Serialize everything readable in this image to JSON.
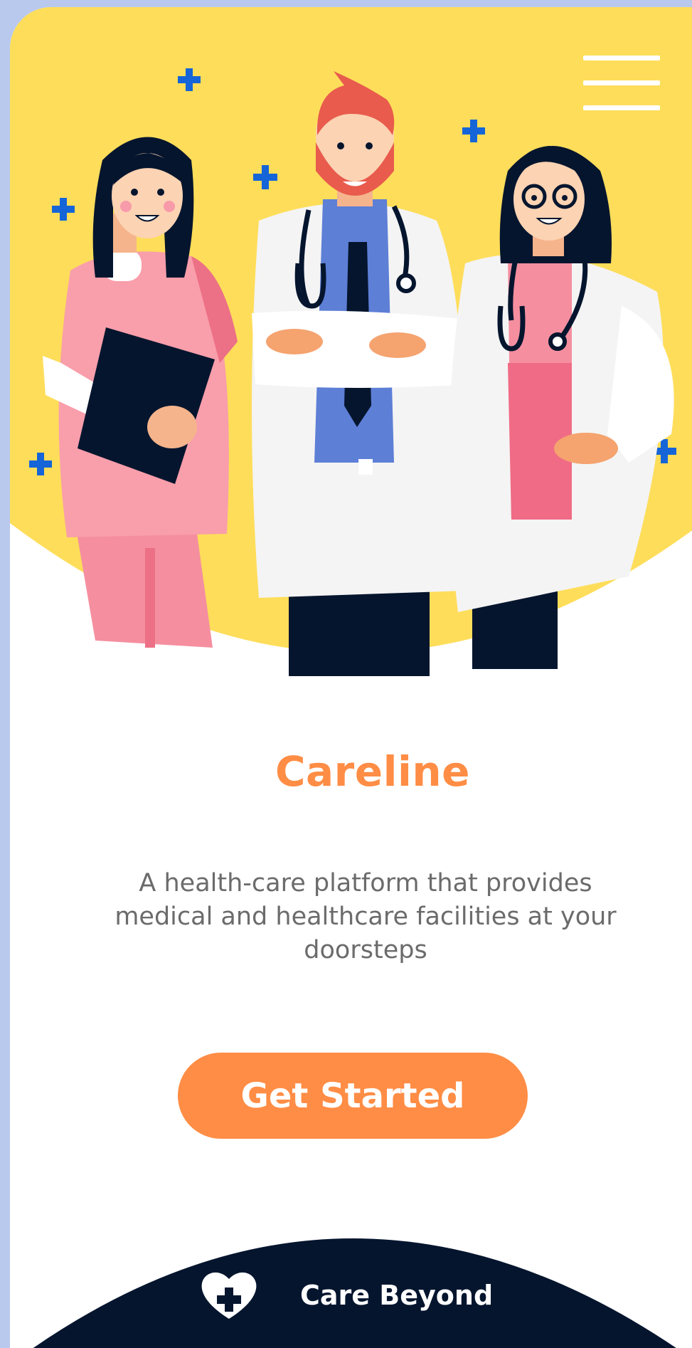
{
  "app": {
    "title": "Careline",
    "tagline": "A health-care platform that provides medical and healthcare facilities at your doorsteps"
  },
  "hero": {
    "illustration": "three-doctors-illustration",
    "background_color": "#fedd5a"
  },
  "menu": {
    "icon": "hamburger-menu-icon"
  },
  "cta": {
    "label": "Get Started",
    "color": "#ff8d45"
  },
  "footer": {
    "brand_label": "Care Beyond",
    "icon": "heart-plus-icon",
    "background_color": "#05152e"
  }
}
